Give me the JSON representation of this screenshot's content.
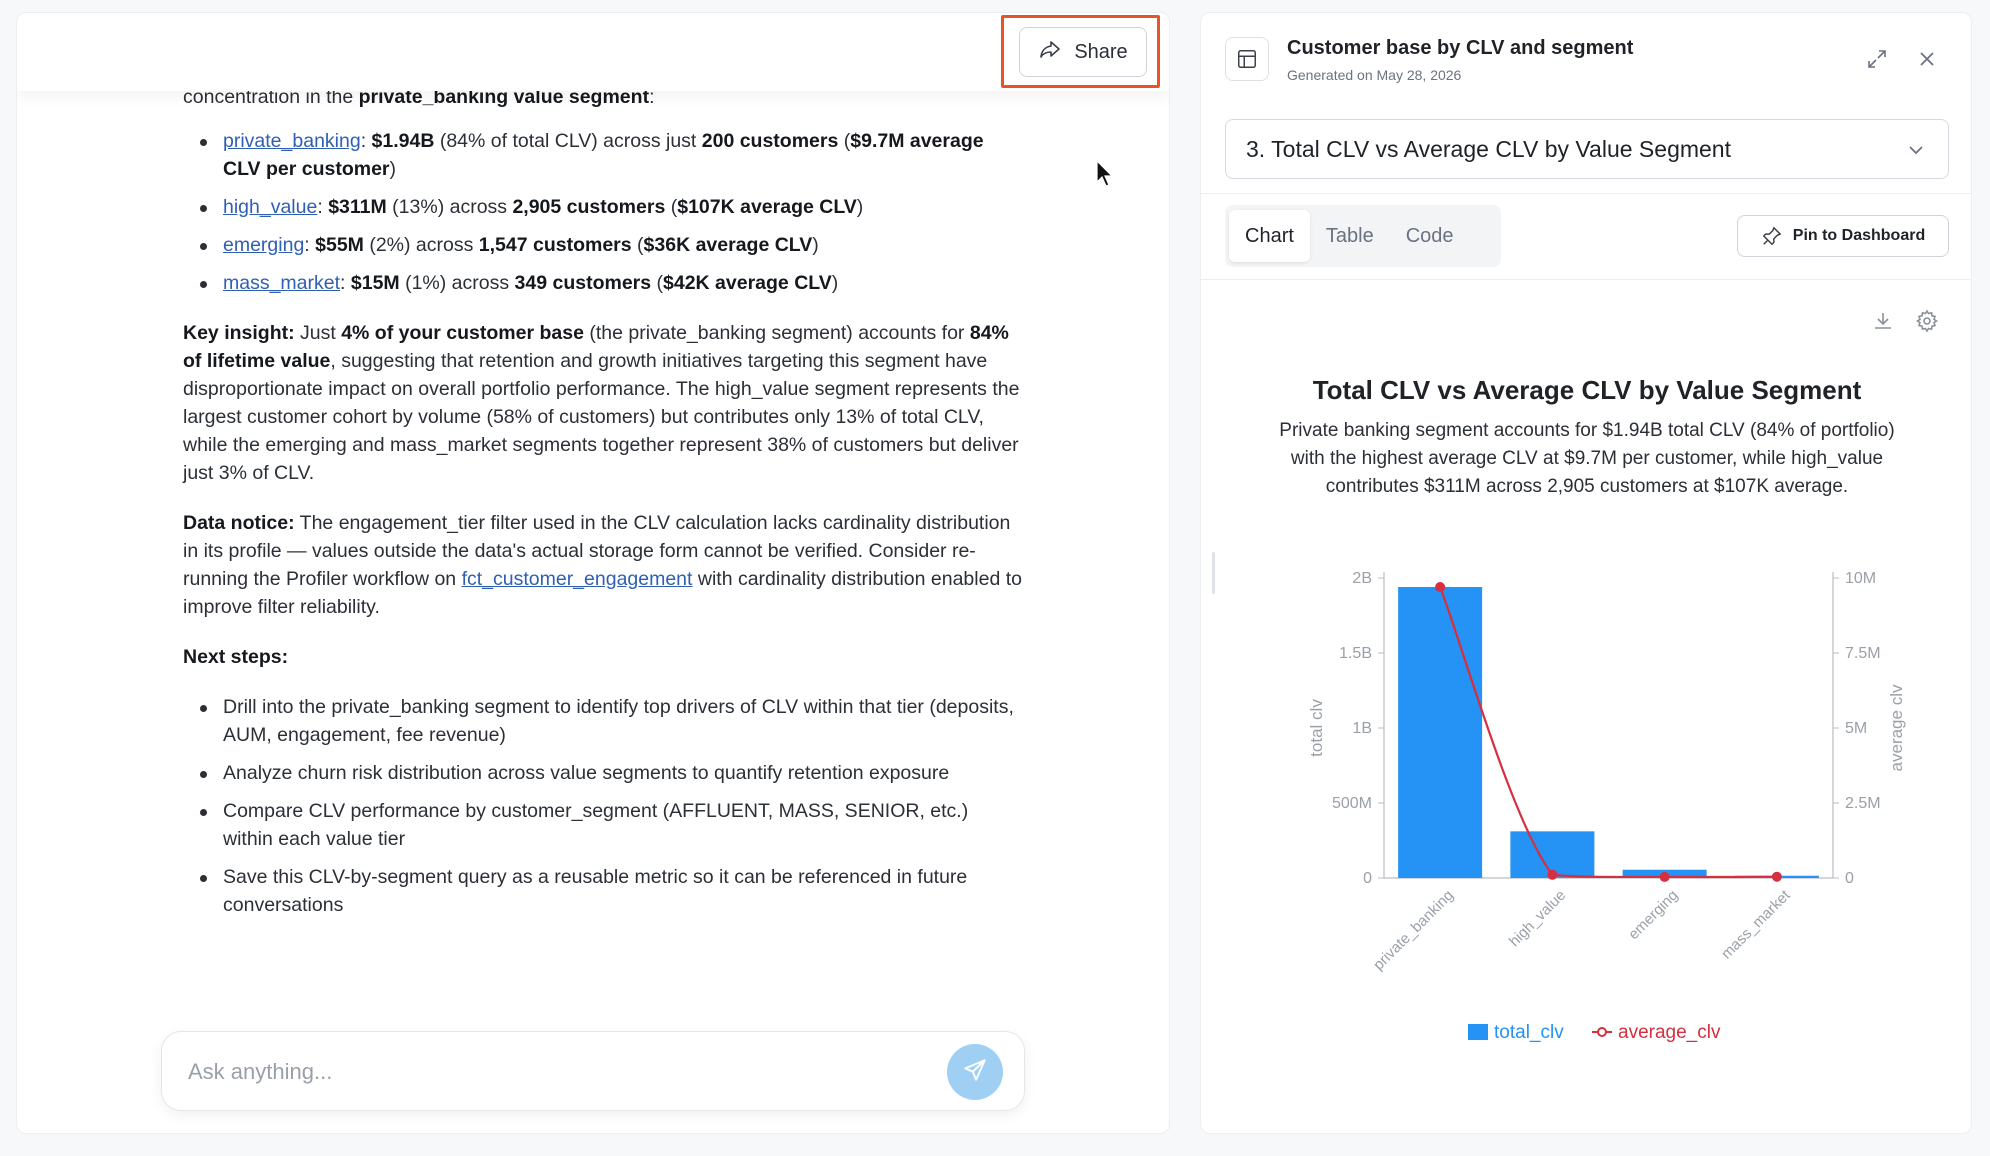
{
  "chat": {
    "share_label": "Share",
    "intro_text": "concentration in the ",
    "intro_bold": "private_banking value segment",
    "intro_end": ":",
    "segments": [
      {
        "link": "private_banking",
        "total": "$1.94B",
        "pct": " (84% of total CLV) across just ",
        "customers": "200 customers",
        "avg_open": " (",
        "avg": "$9.7M average CLV per customer",
        "avg_close": ")"
      },
      {
        "link": "high_value",
        "total": "$311M",
        "pct": " (13%) across ",
        "customers": "2,905 customers",
        "avg_open": " (",
        "avg": "$107K average CLV",
        "avg_close": ")"
      },
      {
        "link": "emerging",
        "total": "$55M",
        "pct": " (2%) across ",
        "customers": "1,547 customers",
        "avg_open": " (",
        "avg": "$36K average CLV",
        "avg_close": ")"
      },
      {
        "link": "mass_market",
        "total": "$15M",
        "pct": " (1%) across ",
        "customers": "349 customers",
        "avg_open": " (",
        "avg": "$42K average CLV",
        "avg_close": ")"
      }
    ],
    "insight_label": "Key insight:",
    "insight_t1": " Just ",
    "insight_b1": "4% of your customer base",
    "insight_t2": " (the private_banking segment) accounts for ",
    "insight_b2": "84% of lifetime value",
    "insight_t3": ", suggesting that retention and growth initiatives targeting this segment have disproportionate impact on overall portfolio performance. The high_value segment represents the largest customer cohort by volume (58% of customers) but contributes only 13% of total CLV, while the emerging and mass_market segments together represent 38% of customers but deliver just 3% of CLV.",
    "notice_label": "Data notice:",
    "notice_t1": " The engagement_tier filter used in the CLV calculation lacks cardinality distribution in its profile — values outside the data's actual storage form cannot be verified. Consider re-running the Profiler workflow on ",
    "notice_link": "fct_customer_engagement",
    "notice_t2": " with cardinality distribution enabled to improve filter reliability.",
    "next_steps_label": "Next steps:",
    "next_steps": [
      "Drill into the private_banking segment to identify top drivers of CLV within that tier (deposits, AUM, engagement, fee revenue)",
      "Analyze churn risk distribution across value segments to quantify retention exposure",
      "Compare CLV performance by customer_segment (AFFLUENT, MASS, SENIOR, etc.) within each value tier",
      "Save this CLV-by-segment query as a reusable metric so it can be referenced in future conversations"
    ],
    "composer_placeholder": "Ask anything..."
  },
  "side": {
    "title": "Customer base by CLV and segment",
    "generated": "Generated on May 28, 2026",
    "dropdown_value": "3. Total CLV vs Average CLV by Value Segment",
    "tabs": [
      "Chart",
      "Table",
      "Code"
    ],
    "active_tab": "Chart",
    "pin_label": "Pin to Dashboard"
  },
  "colors": {
    "bar": "#2592f5",
    "line": "#d62f3f",
    "share_highlight": "#e8542a"
  },
  "chart_data": {
    "type": "bar",
    "title": "Total CLV vs Average CLV by Value Segment",
    "subtitle": "Private banking segment accounts for $1.94B total CLV (84% of portfolio) with the highest average CLV at $9.7M per customer, while high_value contributes $311M across 2,905 customers at $107K average.",
    "categories": [
      "private_banking",
      "high_value",
      "emerging",
      "mass_market"
    ],
    "series": [
      {
        "name": "total_clv",
        "kind": "bar",
        "axis": "left",
        "values": [
          1940000000,
          311000000,
          55000000,
          15000000
        ]
      },
      {
        "name": "average_clv",
        "kind": "line",
        "axis": "right",
        "values": [
          9700000,
          107000,
          36000,
          42000
        ]
      }
    ],
    "ylabel_left": "total clv",
    "ylabel_right": "average clv",
    "ylim_left": [
      0,
      2000000000
    ],
    "ylim_right": [
      0,
      10000000
    ],
    "left_ticks": [
      {
        "v": 0,
        "label": "0"
      },
      {
        "v": 500000000,
        "label": "500M"
      },
      {
        "v": 1000000000,
        "label": "1B"
      },
      {
        "v": 1500000000,
        "label": "1.5B"
      },
      {
        "v": 2000000000,
        "label": "2B"
      }
    ],
    "right_ticks": [
      {
        "v": 0,
        "label": "0"
      },
      {
        "v": 2500000,
        "label": "2.5M"
      },
      {
        "v": 5000000,
        "label": "5M"
      },
      {
        "v": 7500000,
        "label": "7.5M"
      },
      {
        "v": 10000000,
        "label": "10M"
      }
    ],
    "legend_position": "bottom-center",
    "grid": false
  }
}
